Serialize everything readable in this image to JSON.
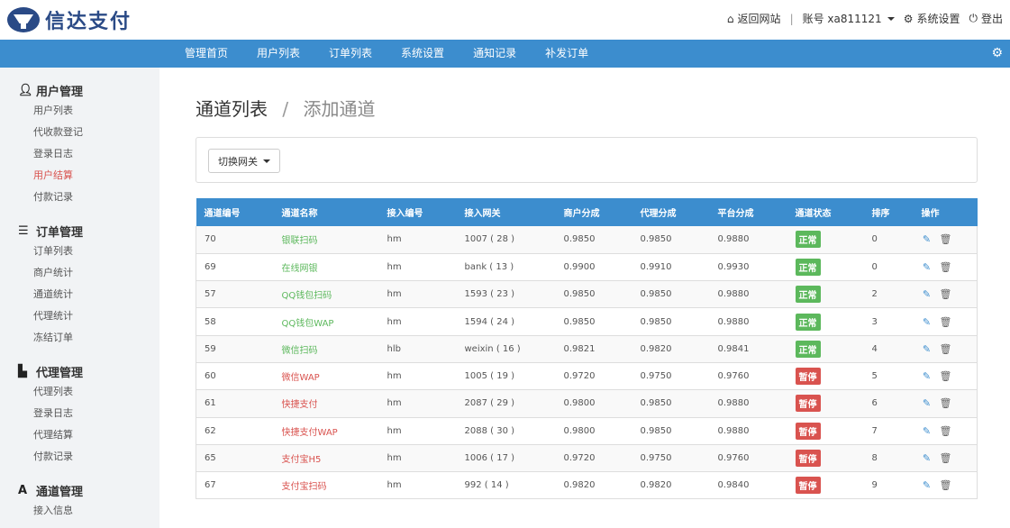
{
  "header": {
    "logo_text": "信达支付",
    "back_label": "返回网站",
    "account_label": "账号 xa811121",
    "settings_label": "系统设置",
    "logout_label": "登出",
    "icons": {
      "back": "home-icon",
      "settings": "gear-icon",
      "logout": "power-icon"
    }
  },
  "navbar": {
    "items": [
      "管理首页",
      "用户列表",
      "订单列表",
      "系统设置",
      "通知记录",
      "补发订单"
    ]
  },
  "sidebar": {
    "groups": [
      {
        "title": "用户管理",
        "icon": "user-icon",
        "items": [
          "用户列表",
          "代收款登记",
          "登录日志",
          "用户结算",
          "付款记录"
        ]
      },
      {
        "title": "订单管理",
        "icon": "list-icon",
        "items": [
          "订单列表",
          "商户统计",
          "通道统计",
          "代理统计",
          "冻结订单"
        ]
      },
      {
        "title": "代理管理",
        "icon": "file-icon",
        "items": [
          "代理列表",
          "登录日志",
          "代理结算",
          "付款记录"
        ]
      },
      {
        "title": "通道管理",
        "icon": "font-icon",
        "items": [
          "接入信息"
        ]
      }
    ],
    "active_item": "用户结算"
  },
  "main": {
    "breadcrumb_main": "通道列表",
    "breadcrumb_sep": "/",
    "breadcrumb_sub": "添加通道",
    "switch_label": "切换网关"
  },
  "table": {
    "columns": [
      "通道编号",
      "通道名称",
      "接入编号",
      "接入网关",
      "商户分成",
      "代理分成",
      "平台分成",
      "通道状态",
      "排序",
      "操作"
    ],
    "rows": [
      {
        "id": "70",
        "name": "银联扫码",
        "code": "hm",
        "gateway": "1007 ( 28 )",
        "merchant": "0.9850",
        "agent": "0.9850",
        "platform": "0.9880",
        "status": "正常",
        "status_type": "ok",
        "sort": "0"
      },
      {
        "id": "69",
        "name": "在线网银",
        "code": "hm",
        "gateway": "bank ( 13 )",
        "merchant": "0.9900",
        "agent": "0.9910",
        "platform": "0.9930",
        "status": "正常",
        "status_type": "ok",
        "sort": "0"
      },
      {
        "id": "57",
        "name": "QQ钱包扫码",
        "code": "hm",
        "gateway": "1593 ( 23 )",
        "merchant": "0.9850",
        "agent": "0.9850",
        "platform": "0.9880",
        "status": "正常",
        "status_type": "ok",
        "sort": "2"
      },
      {
        "id": "58",
        "name": "QQ钱包WAP",
        "code": "hm",
        "gateway": "1594 ( 24 )",
        "merchant": "0.9850",
        "agent": "0.9850",
        "platform": "0.9880",
        "status": "正常",
        "status_type": "ok",
        "sort": "3"
      },
      {
        "id": "59",
        "name": "微信扫码",
        "code": "hlb",
        "gateway": "weixin ( 16 )",
        "merchant": "0.9821",
        "agent": "0.9820",
        "platform": "0.9841",
        "status": "正常",
        "status_type": "ok",
        "sort": "4"
      },
      {
        "id": "60",
        "name": "微信WAP",
        "code": "hm",
        "gateway": "1005 ( 19 )",
        "merchant": "0.9720",
        "agent": "0.9750",
        "platform": "0.9760",
        "status": "暂停",
        "status_type": "stop",
        "sort": "5"
      },
      {
        "id": "61",
        "name": "快捷支付",
        "code": "hm",
        "gateway": "2087 ( 29 )",
        "merchant": "0.9800",
        "agent": "0.9850",
        "platform": "0.9880",
        "status": "暂停",
        "status_type": "stop",
        "sort": "6"
      },
      {
        "id": "62",
        "name": "快捷支付WAP",
        "code": "hm",
        "gateway": "2088 ( 30 )",
        "merchant": "0.9800",
        "agent": "0.9850",
        "platform": "0.9880",
        "status": "暂停",
        "status_type": "stop",
        "sort": "7"
      },
      {
        "id": "65",
        "name": "支付宝H5",
        "code": "hm",
        "gateway": "1006 ( 17 )",
        "merchant": "0.9720",
        "agent": "0.9750",
        "platform": "0.9760",
        "status": "暂停",
        "status_type": "stop",
        "sort": "8"
      },
      {
        "id": "67",
        "name": "支付宝扫码",
        "code": "hm",
        "gateway": "992 ( 14 )",
        "merchant": "0.9820",
        "agent": "0.9820",
        "platform": "0.9840",
        "status": "暂停",
        "status_type": "stop",
        "sort": "9"
      }
    ],
    "op_icons": [
      "edit-icon",
      "trash-icon"
    ]
  },
  "colors": {
    "nav": "#3c8dce",
    "ok": "#5cb85c",
    "stop": "#d9534f",
    "sidebar": "#f1f3f5"
  }
}
